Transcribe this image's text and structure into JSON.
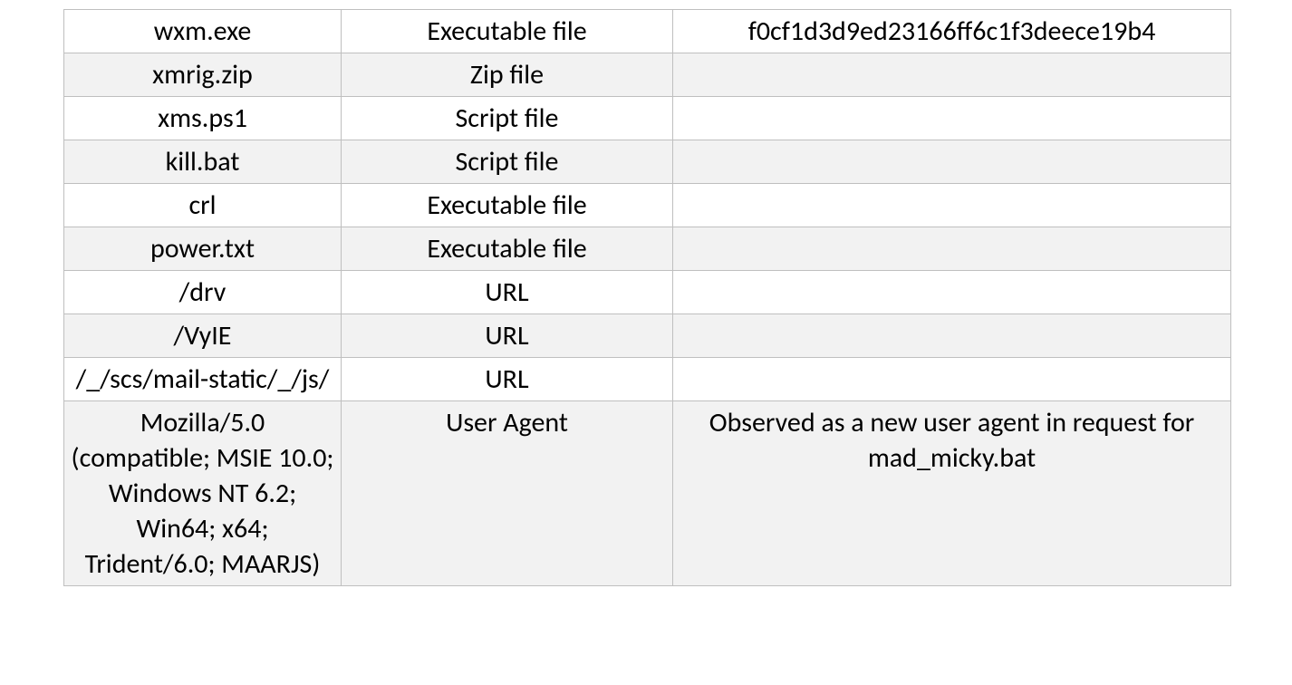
{
  "rows": [
    {
      "indicator": "wxm.exe",
      "type": "Executable file",
      "detail": "f0cf1d3d9ed23166ff6c1f3deece19b4",
      "shade": false
    },
    {
      "indicator": "xmrig.zip",
      "type": "Zip file",
      "detail": "",
      "shade": true
    },
    {
      "indicator": "xms.ps1",
      "type": "Script file",
      "detail": "",
      "shade": false
    },
    {
      "indicator": "kill.bat",
      "type": "Script file",
      "detail": "",
      "shade": true
    },
    {
      "indicator": "crl",
      "type": "Executable file",
      "detail": "",
      "shade": false
    },
    {
      "indicator": "power.txt",
      "type": "Executable file",
      "detail": "",
      "shade": true
    },
    {
      "indicator": "/drv",
      "type": "URL",
      "detail": "",
      "shade": false
    },
    {
      "indicator": "/VyIE",
      "type": "URL",
      "detail": "",
      "shade": true
    },
    {
      "indicator": "/_/scs/mail-static/_/js/",
      "type": "URL",
      "detail": "",
      "shade": false
    },
    {
      "indicator": "Mozilla/5.0 (compatible; MSIE 10.0; Windows NT 6.2; Win64; x64; Trident/6.0; MAARJS)",
      "type": "User Agent",
      "detail": "Observed as a new user agent in request for mad_micky.bat",
      "shade": true
    }
  ]
}
